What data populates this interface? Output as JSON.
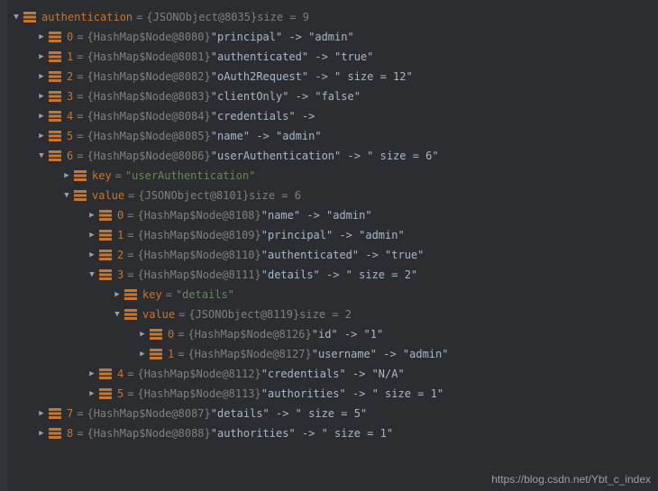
{
  "watermark": "https://blog.csdn.net/Ybt_c_index",
  "rows": [
    {
      "indent": 0,
      "arrow": "down",
      "name": "authentication",
      "eq": " = ",
      "ref": "{JSONObject@8035}",
      "tail": "  size = 9",
      "nameClass": "var-name",
      "tailClass": "size-label"
    },
    {
      "indent": 1,
      "arrow": "right",
      "name": "0",
      "eq": " = ",
      "ref": "{HashMap$Node@8080}",
      "tail": " \"principal\" -> \"admin\"",
      "nameClass": "var-name",
      "tailClass": "str"
    },
    {
      "indent": 1,
      "arrow": "right",
      "name": "1",
      "eq": " = ",
      "ref": "{HashMap$Node@8081}",
      "tail": " \"authenticated\" -> \"true\"",
      "nameClass": "var-name",
      "tailClass": "str"
    },
    {
      "indent": 1,
      "arrow": "right",
      "name": "2",
      "eq": " = ",
      "ref": "{HashMap$Node@8082}",
      "tail": " \"oAuth2Request\" -> \" size = 12\"",
      "nameClass": "var-name",
      "tailClass": "str"
    },
    {
      "indent": 1,
      "arrow": "right",
      "name": "3",
      "eq": " = ",
      "ref": "{HashMap$Node@8083}",
      "tail": " \"clientOnly\" -> \"false\"",
      "nameClass": "var-name",
      "tailClass": "str"
    },
    {
      "indent": 1,
      "arrow": "right",
      "name": "4",
      "eq": " = ",
      "ref": "{HashMap$Node@8084}",
      "tail": " \"credentials\" ->",
      "nameClass": "var-name",
      "tailClass": "str"
    },
    {
      "indent": 1,
      "arrow": "right",
      "name": "5",
      "eq": " = ",
      "ref": "{HashMap$Node@8085}",
      "tail": " \"name\" -> \"admin\"",
      "nameClass": "var-name",
      "tailClass": "str"
    },
    {
      "indent": 1,
      "arrow": "down",
      "name": "6",
      "eq": " = ",
      "ref": "{HashMap$Node@8086}",
      "tail": " \"userAuthentication\" -> \" size = 6\"",
      "nameClass": "var-name",
      "tailClass": "str"
    },
    {
      "indent": 2,
      "arrow": "right",
      "name": "key",
      "eq": " = ",
      "ref": "",
      "tail": "\"userAuthentication\"",
      "nameClass": "var-name",
      "tailClass": "key-green"
    },
    {
      "indent": 2,
      "arrow": "down",
      "name": "value",
      "eq": " = ",
      "ref": "{JSONObject@8101}",
      "tail": "  size = 6",
      "nameClass": "var-name",
      "tailClass": "size-label"
    },
    {
      "indent": 3,
      "arrow": "right",
      "name": "0",
      "eq": " = ",
      "ref": "{HashMap$Node@8108}",
      "tail": " \"name\" -> \"admin\"",
      "nameClass": "var-name",
      "tailClass": "str"
    },
    {
      "indent": 3,
      "arrow": "right",
      "name": "1",
      "eq": " = ",
      "ref": "{HashMap$Node@8109}",
      "tail": " \"principal\" -> \"admin\"",
      "nameClass": "var-name",
      "tailClass": "str"
    },
    {
      "indent": 3,
      "arrow": "right",
      "name": "2",
      "eq": " = ",
      "ref": "{HashMap$Node@8110}",
      "tail": " \"authenticated\" -> \"true\"",
      "nameClass": "var-name",
      "tailClass": "str"
    },
    {
      "indent": 3,
      "arrow": "down",
      "name": "3",
      "eq": " = ",
      "ref": "{HashMap$Node@8111}",
      "tail": " \"details\" -> \" size = 2\"",
      "nameClass": "var-name",
      "tailClass": "str"
    },
    {
      "indent": 4,
      "arrow": "right",
      "name": "key",
      "eq": " = ",
      "ref": "",
      "tail": "\"details\"",
      "nameClass": "var-name",
      "tailClass": "key-green"
    },
    {
      "indent": 4,
      "arrow": "down",
      "name": "value",
      "eq": " = ",
      "ref": "{JSONObject@8119}",
      "tail": "  size = 2",
      "nameClass": "var-name",
      "tailClass": "size-label"
    },
    {
      "indent": 5,
      "arrow": "right",
      "name": "0",
      "eq": " = ",
      "ref": "{HashMap$Node@8126}",
      "tail": " \"id\" -> \"1\"",
      "nameClass": "var-name",
      "tailClass": "str"
    },
    {
      "indent": 5,
      "arrow": "right",
      "name": "1",
      "eq": " = ",
      "ref": "{HashMap$Node@8127}",
      "tail": " \"username\" -> \"admin\"",
      "nameClass": "var-name",
      "tailClass": "str"
    },
    {
      "indent": 3,
      "arrow": "right",
      "name": "4",
      "eq": " = ",
      "ref": "{HashMap$Node@8112}",
      "tail": " \"credentials\" -> \"N/A\"",
      "nameClass": "var-name",
      "tailClass": "str"
    },
    {
      "indent": 3,
      "arrow": "right",
      "name": "5",
      "eq": " = ",
      "ref": "{HashMap$Node@8113}",
      "tail": " \"authorities\" -> \" size = 1\"",
      "nameClass": "var-name",
      "tailClass": "str"
    },
    {
      "indent": 1,
      "arrow": "right",
      "name": "7",
      "eq": " = ",
      "ref": "{HashMap$Node@8087}",
      "tail": " \"details\" -> \" size = 5\"",
      "nameClass": "var-name",
      "tailClass": "str"
    },
    {
      "indent": 1,
      "arrow": "right",
      "name": "8",
      "eq": " = ",
      "ref": "{HashMap$Node@8088}",
      "tail": " \"authorities\" -> \" size = 1\"",
      "nameClass": "var-name",
      "tailClass": "str"
    }
  ]
}
